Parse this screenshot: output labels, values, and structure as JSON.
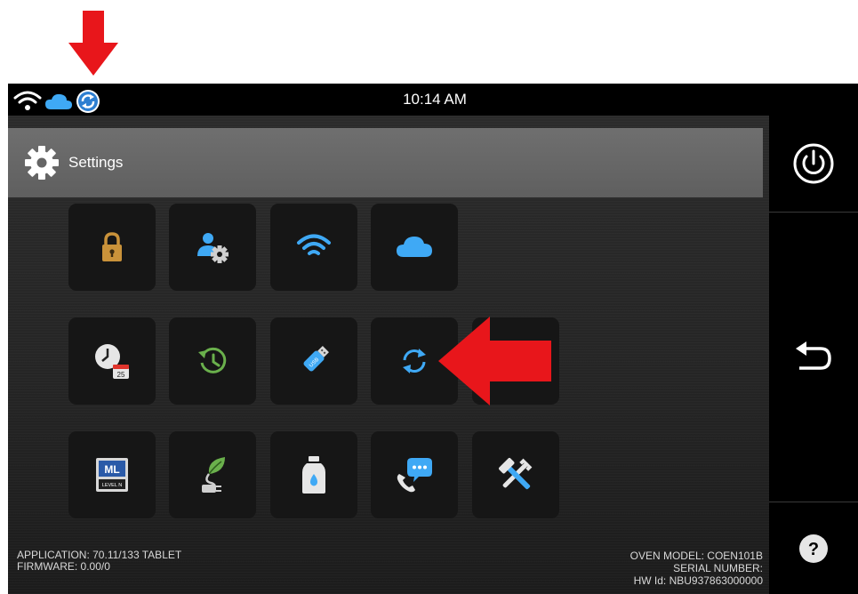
{
  "status_bar": {
    "time": "10:14 AM",
    "icons": [
      "wifi-icon",
      "cloud-icon",
      "sync-icon"
    ]
  },
  "header": {
    "title": "Settings",
    "icon": "gear-icon"
  },
  "tiles": [
    {
      "name": "security",
      "icon": "padlock-icon"
    },
    {
      "name": "user-settings",
      "icon": "user-gear-icon"
    },
    {
      "name": "wifi",
      "icon": "wifi-icon"
    },
    {
      "name": "cloud",
      "icon": "cloud-icon"
    },
    {
      "name": "date-time",
      "icon": "clock-calendar-icon"
    },
    {
      "name": "history",
      "icon": "history-icon"
    },
    {
      "name": "usb",
      "icon": "usb-drive-icon"
    },
    {
      "name": "sync",
      "icon": "sync-icon"
    },
    {
      "name": "level",
      "icon": "level-ml-icon",
      "text_main": "ML",
      "text_sub": "LEVEL N"
    },
    {
      "name": "eco-power",
      "icon": "leaf-plug-icon"
    },
    {
      "name": "water",
      "icon": "water-bottle-icon"
    },
    {
      "name": "contact",
      "icon": "phone-chat-icon"
    },
    {
      "name": "service-tools",
      "icon": "tools-icon"
    }
  ],
  "right_panel": {
    "buttons": [
      "power-icon",
      "back-icon",
      "help-icon"
    ]
  },
  "footer": {
    "application": "APPLICATION: 70.11/133 TABLET",
    "firmware": "FIRMWARE: 0.00/0",
    "oven_model": "OVEN MODEL: COEN101B",
    "serial_number": "SERIAL NUMBER:",
    "hw_id": "HW Id: NBU937863000000"
  },
  "colors": {
    "accent_blue": "#3fa9f5",
    "annotation_red": "#e8161b",
    "lock_gold": "#c9923a",
    "eco_green": "#6ab04c"
  }
}
